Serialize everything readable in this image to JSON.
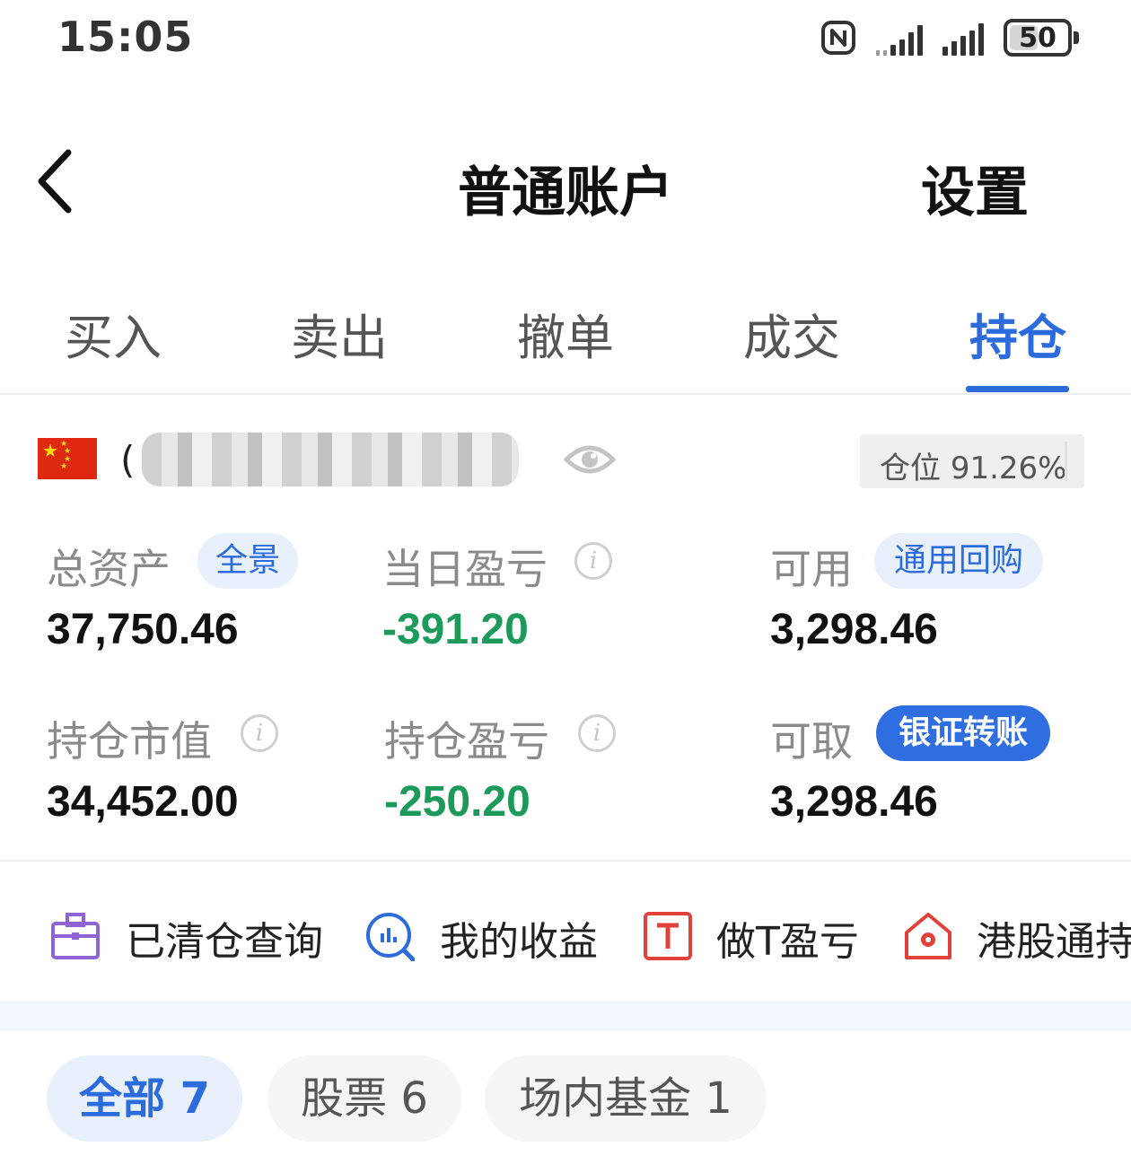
{
  "status_bar": {
    "time": "15:05",
    "battery": "50",
    "battery_level": 0.5,
    "icons": [
      "nfc-icon",
      "signal-icon",
      "signal-icon",
      "battery-icon"
    ]
  },
  "header": {
    "title": "普通账户",
    "settings_label": "设置",
    "back_icon": "chevron-left-icon"
  },
  "tabs": [
    {
      "label": "买入",
      "active": false
    },
    {
      "label": "卖出",
      "active": false
    },
    {
      "label": "撤单",
      "active": false
    },
    {
      "label": "成交",
      "active": false
    },
    {
      "label": "持仓",
      "active": true
    }
  ],
  "account": {
    "flag_icon": "china-flag-icon",
    "name_prefix": "(",
    "visibility_icon": "eye-icon",
    "position_label": "仓位",
    "position_value": "91.26%"
  },
  "metrics": {
    "total_assets": {
      "label": "总资产",
      "value": "37,750.46",
      "action": "全景"
    },
    "daily_pnl": {
      "label": "当日盈亏",
      "value": "-391.20"
    },
    "available": {
      "label": "可用",
      "value": "3,298.46",
      "action": "通用回购"
    },
    "market_value": {
      "label": "持仓市值",
      "value": "34,452.00"
    },
    "position_pnl": {
      "label": "持仓盈亏",
      "value": "-250.20"
    },
    "withdrawable": {
      "label": "可取",
      "value": "3,298.46",
      "action": "银证转账"
    }
  },
  "quick_links": [
    {
      "label": "已清仓查询",
      "icon": "briefcase-icon"
    },
    {
      "label": "我的收益",
      "icon": "chart-search-icon"
    },
    {
      "label": "做T盈亏",
      "icon": "t-box-icon"
    },
    {
      "label": "港股通持",
      "icon": "hk-house-icon"
    }
  ],
  "filters": [
    {
      "label": "全部 7",
      "active": true
    },
    {
      "label": "股票 6",
      "active": false
    },
    {
      "label": "场内基金 1",
      "active": false
    }
  ],
  "colors": {
    "accent": "#2c6bdc",
    "negative": "#1b9a5a",
    "label_gray": "#8a8a8a"
  }
}
